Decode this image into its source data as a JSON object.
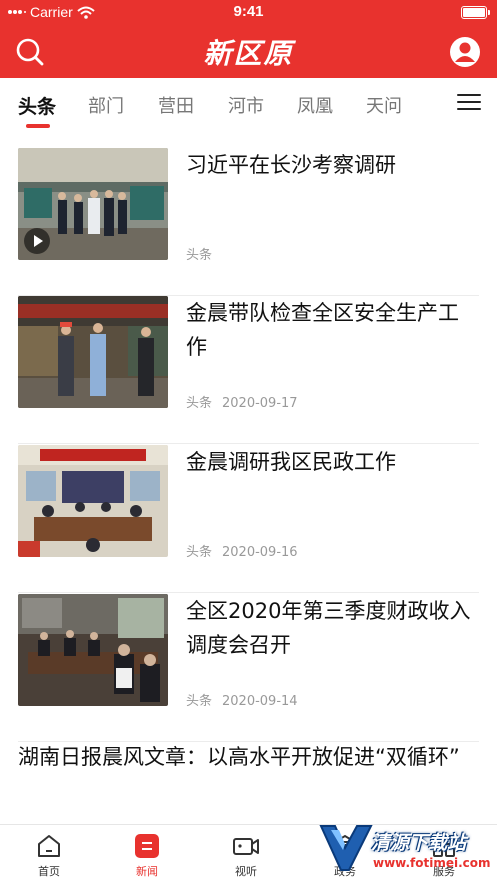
{
  "status_bar": {
    "carrier": "Carrier",
    "time": "9:41"
  },
  "header": {
    "logo_text": "新区原",
    "search_icon": "search-icon",
    "user_icon": "user-icon"
  },
  "tabs": [
    {
      "label": "头条",
      "active": true
    },
    {
      "label": "部门",
      "active": false
    },
    {
      "label": "营田",
      "active": false
    },
    {
      "label": "河市",
      "active": false
    },
    {
      "label": "凤凰",
      "active": false
    },
    {
      "label": "天问",
      "active": false
    }
  ],
  "news": [
    {
      "title": "习近平在长沙考察调研",
      "source": "头条",
      "date": "",
      "has_video": true
    },
    {
      "title": "金晨带队检查全区安全生产工作",
      "source": "头条",
      "date": "2020-09-17",
      "has_video": false
    },
    {
      "title": "金晨调研我区民政工作",
      "source": "头条",
      "date": "2020-09-16",
      "has_video": false
    },
    {
      "title": "全区2020年第三季度财政收入调度会召开",
      "source": "头条",
      "date": "2020-09-14",
      "has_video": false
    }
  ],
  "wide_news": {
    "title": "湖南日报晨风文章：以高水平开放促进“双循环”"
  },
  "tab_bar": [
    {
      "label": "首页",
      "icon": "home-icon",
      "active": false
    },
    {
      "label": "新闻",
      "icon": "news-icon",
      "active": true
    },
    {
      "label": "视听",
      "icon": "video-icon",
      "active": false
    },
    {
      "label": "政务",
      "icon": "government-icon",
      "active": false
    },
    {
      "label": "服务",
      "icon": "service-icon",
      "active": false
    }
  ],
  "watermark": {
    "text": "清源下载站",
    "url": "www.fotimei.com"
  },
  "colors": {
    "brand_red": "#e8322e",
    "text_dark": "#111111",
    "meta_gray": "#999999"
  }
}
